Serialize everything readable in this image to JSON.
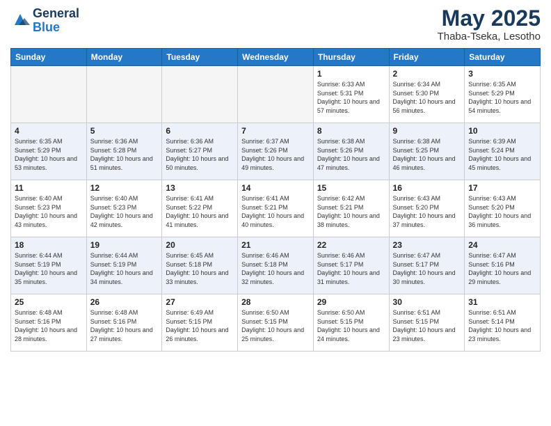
{
  "header": {
    "logo_general": "General",
    "logo_blue": "Blue",
    "month_year": "May 2025",
    "location": "Thaba-Tseka, Lesotho"
  },
  "days_of_week": [
    "Sunday",
    "Monday",
    "Tuesday",
    "Wednesday",
    "Thursday",
    "Friday",
    "Saturday"
  ],
  "weeks": [
    [
      {
        "num": "",
        "empty": true
      },
      {
        "num": "",
        "empty": true
      },
      {
        "num": "",
        "empty": true
      },
      {
        "num": "",
        "empty": true
      },
      {
        "num": "1",
        "sunrise": "6:33 AM",
        "sunset": "5:31 PM",
        "daylight": "10 hours and 57 minutes."
      },
      {
        "num": "2",
        "sunrise": "6:34 AM",
        "sunset": "5:30 PM",
        "daylight": "10 hours and 56 minutes."
      },
      {
        "num": "3",
        "sunrise": "6:35 AM",
        "sunset": "5:29 PM",
        "daylight": "10 hours and 54 minutes."
      }
    ],
    [
      {
        "num": "4",
        "sunrise": "6:35 AM",
        "sunset": "5:29 PM",
        "daylight": "10 hours and 53 minutes."
      },
      {
        "num": "5",
        "sunrise": "6:36 AM",
        "sunset": "5:28 PM",
        "daylight": "10 hours and 51 minutes."
      },
      {
        "num": "6",
        "sunrise": "6:36 AM",
        "sunset": "5:27 PM",
        "daylight": "10 hours and 50 minutes."
      },
      {
        "num": "7",
        "sunrise": "6:37 AM",
        "sunset": "5:26 PM",
        "daylight": "10 hours and 49 minutes."
      },
      {
        "num": "8",
        "sunrise": "6:38 AM",
        "sunset": "5:26 PM",
        "daylight": "10 hours and 47 minutes."
      },
      {
        "num": "9",
        "sunrise": "6:38 AM",
        "sunset": "5:25 PM",
        "daylight": "10 hours and 46 minutes."
      },
      {
        "num": "10",
        "sunrise": "6:39 AM",
        "sunset": "5:24 PM",
        "daylight": "10 hours and 45 minutes."
      }
    ],
    [
      {
        "num": "11",
        "sunrise": "6:40 AM",
        "sunset": "5:23 PM",
        "daylight": "10 hours and 43 minutes."
      },
      {
        "num": "12",
        "sunrise": "6:40 AM",
        "sunset": "5:23 PM",
        "daylight": "10 hours and 42 minutes."
      },
      {
        "num": "13",
        "sunrise": "6:41 AM",
        "sunset": "5:22 PM",
        "daylight": "10 hours and 41 minutes."
      },
      {
        "num": "14",
        "sunrise": "6:41 AM",
        "sunset": "5:21 PM",
        "daylight": "10 hours and 40 minutes."
      },
      {
        "num": "15",
        "sunrise": "6:42 AM",
        "sunset": "5:21 PM",
        "daylight": "10 hours and 38 minutes."
      },
      {
        "num": "16",
        "sunrise": "6:43 AM",
        "sunset": "5:20 PM",
        "daylight": "10 hours and 37 minutes."
      },
      {
        "num": "17",
        "sunrise": "6:43 AM",
        "sunset": "5:20 PM",
        "daylight": "10 hours and 36 minutes."
      }
    ],
    [
      {
        "num": "18",
        "sunrise": "6:44 AM",
        "sunset": "5:19 PM",
        "daylight": "10 hours and 35 minutes."
      },
      {
        "num": "19",
        "sunrise": "6:44 AM",
        "sunset": "5:19 PM",
        "daylight": "10 hours and 34 minutes."
      },
      {
        "num": "20",
        "sunrise": "6:45 AM",
        "sunset": "5:18 PM",
        "daylight": "10 hours and 33 minutes."
      },
      {
        "num": "21",
        "sunrise": "6:46 AM",
        "sunset": "5:18 PM",
        "daylight": "10 hours and 32 minutes."
      },
      {
        "num": "22",
        "sunrise": "6:46 AM",
        "sunset": "5:17 PM",
        "daylight": "10 hours and 31 minutes."
      },
      {
        "num": "23",
        "sunrise": "6:47 AM",
        "sunset": "5:17 PM",
        "daylight": "10 hours and 30 minutes."
      },
      {
        "num": "24",
        "sunrise": "6:47 AM",
        "sunset": "5:16 PM",
        "daylight": "10 hours and 29 minutes."
      }
    ],
    [
      {
        "num": "25",
        "sunrise": "6:48 AM",
        "sunset": "5:16 PM",
        "daylight": "10 hours and 28 minutes."
      },
      {
        "num": "26",
        "sunrise": "6:48 AM",
        "sunset": "5:16 PM",
        "daylight": "10 hours and 27 minutes."
      },
      {
        "num": "27",
        "sunrise": "6:49 AM",
        "sunset": "5:15 PM",
        "daylight": "10 hours and 26 minutes."
      },
      {
        "num": "28",
        "sunrise": "6:50 AM",
        "sunset": "5:15 PM",
        "daylight": "10 hours and 25 minutes."
      },
      {
        "num": "29",
        "sunrise": "6:50 AM",
        "sunset": "5:15 PM",
        "daylight": "10 hours and 24 minutes."
      },
      {
        "num": "30",
        "sunrise": "6:51 AM",
        "sunset": "5:15 PM",
        "daylight": "10 hours and 23 minutes."
      },
      {
        "num": "31",
        "sunrise": "6:51 AM",
        "sunset": "5:14 PM",
        "daylight": "10 hours and 23 minutes."
      }
    ]
  ]
}
